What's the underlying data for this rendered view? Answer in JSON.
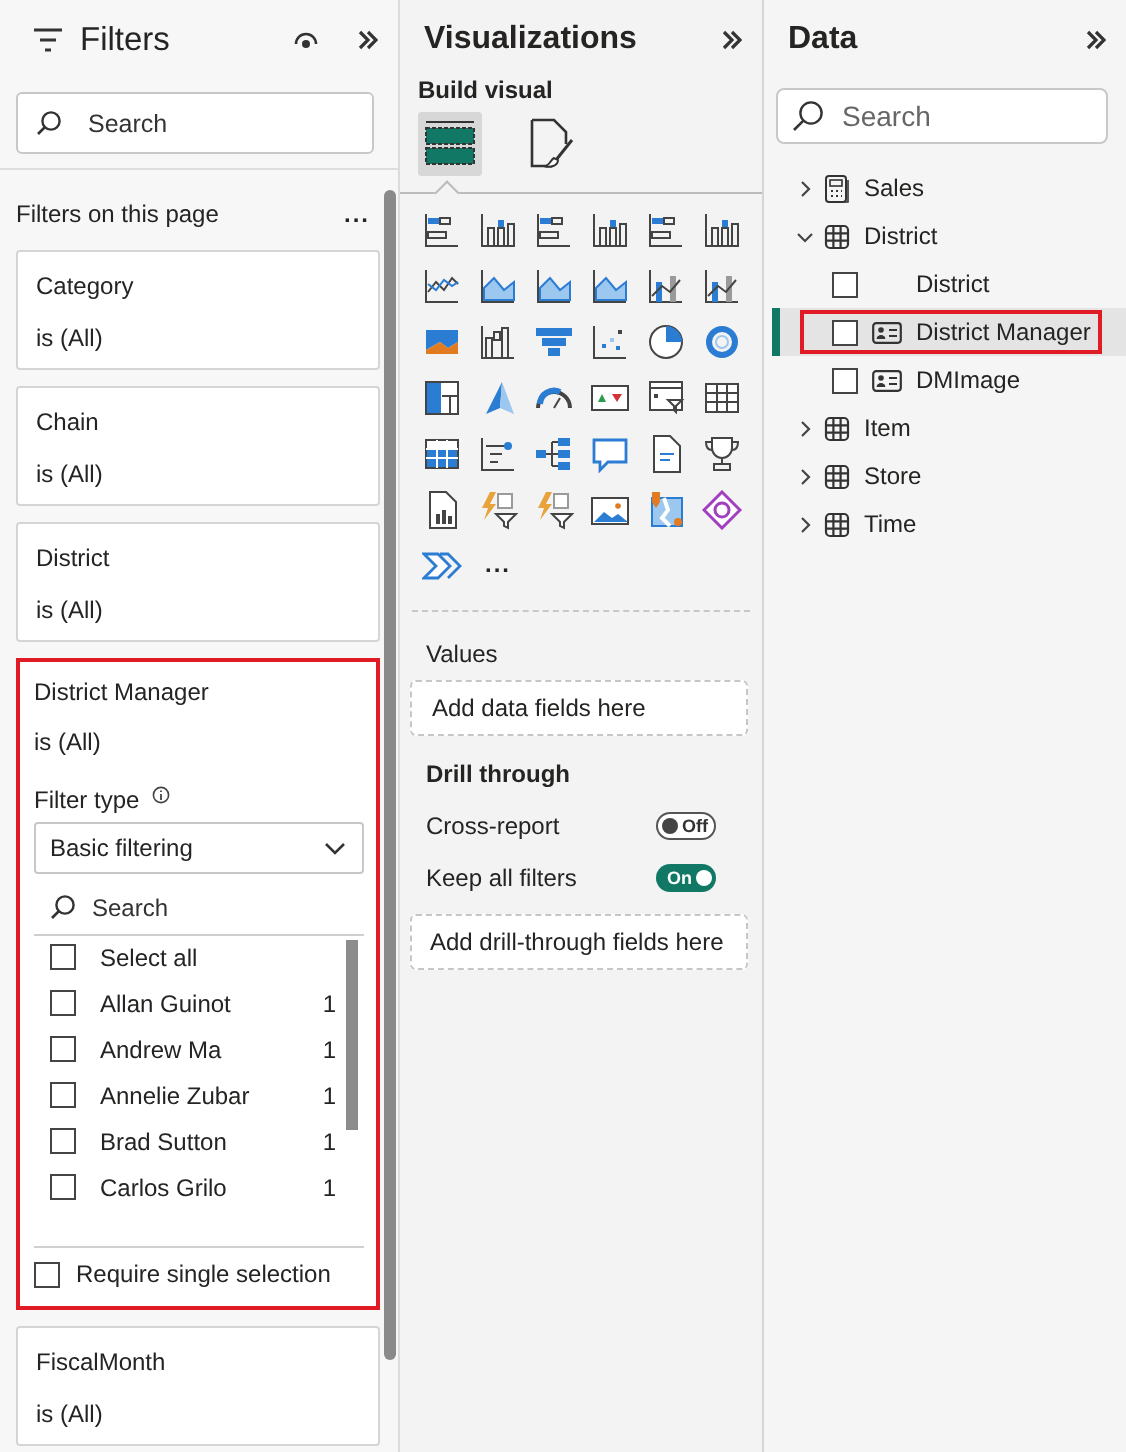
{
  "filters": {
    "title": "Filters",
    "search_placeholder": "Search",
    "section_label": "Filters on this page",
    "section_more": "...",
    "cards": [
      {
        "field": "Category",
        "summary": "is (All)",
        "highlighted": false
      },
      {
        "field": "Chain",
        "summary": "is (All)",
        "highlighted": false
      },
      {
        "field": "District",
        "summary": "is (All)",
        "highlighted": false
      },
      {
        "field": "District Manager",
        "summary": "is (All)",
        "highlighted": true,
        "filter_type_label": "Filter type",
        "filter_type_value": "Basic filtering",
        "search_placeholder": "Search",
        "items": [
          {
            "label": "Select all",
            "checked": false
          },
          {
            "label": "Allan Guinot",
            "count": "1",
            "checked": false
          },
          {
            "label": "Andrew Ma",
            "count": "1",
            "checked": false
          },
          {
            "label": "Annelie Zubar",
            "count": "1",
            "checked": false
          },
          {
            "label": "Brad Sutton",
            "count": "1",
            "checked": false
          },
          {
            "label": "Carlos Grilo",
            "count": "1",
            "checked": false
          }
        ],
        "require_single": {
          "label": "Require single selection",
          "checked": false
        }
      },
      {
        "field": "FiscalMonth",
        "summary": "is (All)",
        "highlighted": false
      }
    ]
  },
  "visualizations": {
    "title": "Visualizations",
    "build_label": "Build visual",
    "build_tabs": [
      {
        "selected": true
      },
      {
        "selected": false
      }
    ],
    "more_visuals": "...",
    "values_label": "Values",
    "values_placeholder": "Add data fields here",
    "drill_title": "Drill through",
    "toggles": [
      {
        "label": "Cross-report",
        "on": false,
        "state_text": "Off"
      },
      {
        "label": "Keep all filters",
        "on": true,
        "state_text": "On"
      }
    ],
    "drill_placeholder": "Add drill-through fields here"
  },
  "data": {
    "title": "Data",
    "search_placeholder": "Search",
    "tree": [
      {
        "label": "Sales",
        "kind": "measures",
        "expanded": false
      },
      {
        "label": "District",
        "kind": "table",
        "expanded": true,
        "children": [
          {
            "label": "District",
            "kind": "field",
            "checked": false,
            "selected": false,
            "highlighted": false
          },
          {
            "label": "District Manager",
            "kind": "card-field",
            "checked": false,
            "selected": true,
            "highlighted": true
          },
          {
            "label": "DMImage",
            "kind": "card-field",
            "checked": false,
            "selected": false,
            "highlighted": false
          }
        ]
      },
      {
        "label": "Item",
        "kind": "table",
        "expanded": false
      },
      {
        "label": "Store",
        "kind": "table",
        "expanded": false
      },
      {
        "label": "Time",
        "kind": "table",
        "expanded": false
      }
    ]
  }
}
